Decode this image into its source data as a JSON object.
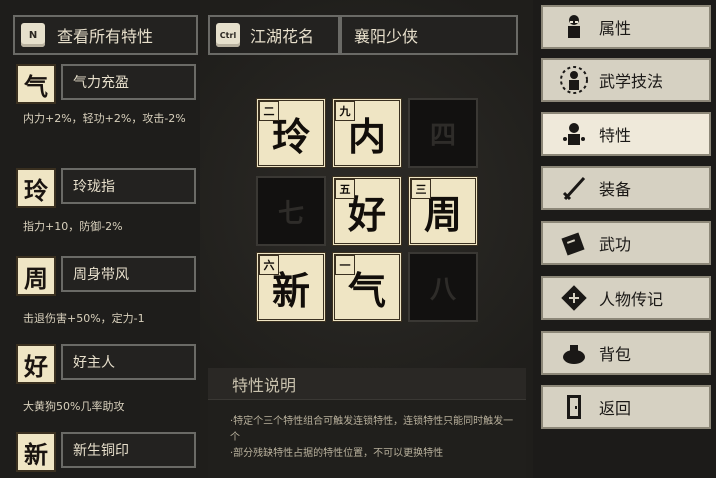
{
  "left": {
    "header": {
      "key": "N",
      "label": "查看所有特性"
    },
    "traits": [
      {
        "icon": "气",
        "rank": "",
        "name": "气力充盈",
        "desc": "内力+2%，轻功+2%，攻击-2%"
      },
      {
        "icon": "玲",
        "rank": "",
        "name": "玲珑指",
        "desc": "指力+10，防御-2%"
      },
      {
        "icon": "周",
        "rank": "",
        "name": "周身带风",
        "desc": "击退伤害+50%，定力-1"
      },
      {
        "icon": "好",
        "rank": "",
        "name": "好主人",
        "desc": "大黄狗50%几率助攻"
      },
      {
        "icon": "新",
        "rank": "",
        "name": "新生铜印",
        "desc": ""
      }
    ]
  },
  "middle": {
    "tab_key": "Ctrl",
    "tab_label": "江湖花名",
    "nickname": "襄阳少侠",
    "grid": [
      {
        "char": "玲",
        "rank": "二",
        "filled": true
      },
      {
        "char": "内",
        "rank": "九",
        "filled": true
      },
      {
        "char": "四",
        "rank": "",
        "filled": false
      },
      {
        "char": "七",
        "rank": "",
        "filled": false
      },
      {
        "char": "好",
        "rank": "五",
        "filled": true
      },
      {
        "char": "周",
        "rank": "三",
        "filled": true
      },
      {
        "char": "新",
        "rank": "六",
        "filled": true
      },
      {
        "char": "气",
        "rank": "一",
        "filled": true
      },
      {
        "char": "八",
        "rank": "",
        "filled": false
      }
    ],
    "desc_title": "特性说明",
    "desc_lines": [
      "·特定个三个特性组合可触发连锁特性，连锁特性只能同时触发一个",
      "·部分残缺特性占据的特性位置，不可以更换特性"
    ]
  },
  "menu": {
    "items": [
      {
        "label": "属性",
        "icon": "figure-icon"
      },
      {
        "label": "武学技法",
        "icon": "skill-figure-icon"
      },
      {
        "label": "特性",
        "icon": "trait-figure-icon"
      },
      {
        "label": "装备",
        "icon": "sword-icon"
      },
      {
        "label": "武功",
        "icon": "martial-book-icon"
      },
      {
        "label": "人物传记",
        "icon": "biography-icon"
      },
      {
        "label": "背包",
        "icon": "bag-icon"
      },
      {
        "label": "返回",
        "icon": "door-icon"
      }
    ],
    "active_index": 2
  }
}
